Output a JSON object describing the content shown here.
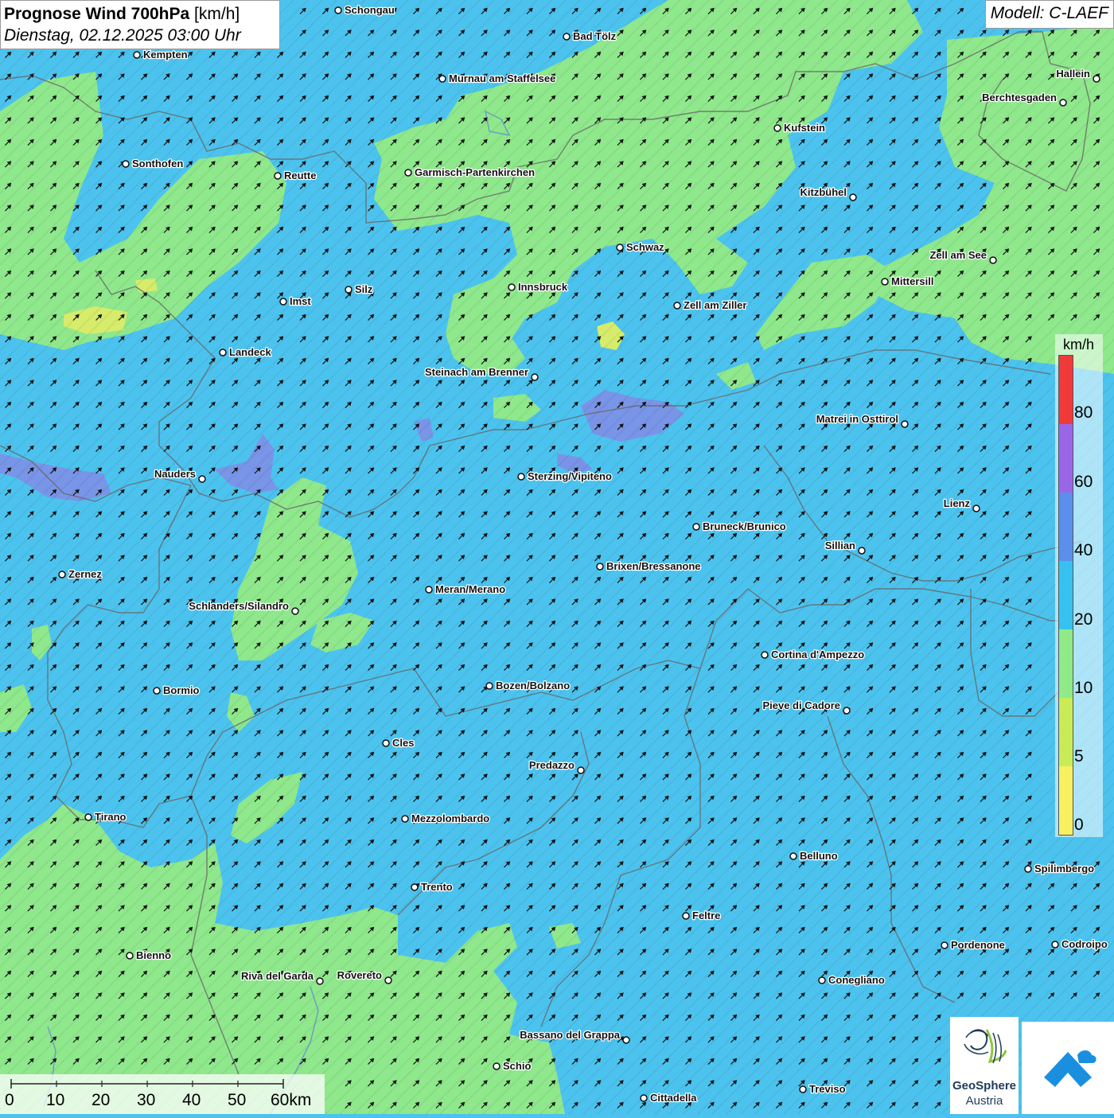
{
  "header": {
    "title_bold": "Prognose Wind 700hPa",
    "title_unit": "[km/h]",
    "datetime": "Dienstag, 02.12.2025 03:00 Uhr",
    "model": "Modell: C-LAEF"
  },
  "legend": {
    "unit": "km/h",
    "ticks": [
      "0",
      "5",
      "10",
      "20",
      "40",
      "60",
      "80"
    ],
    "colors": [
      "#f8f060",
      "#c8ec58",
      "#90ea88",
      "#36c2f0",
      "#5a90ec",
      "#9a66e8",
      "#f03a3a"
    ]
  },
  "scale": {
    "ticks": [
      "0",
      "10",
      "20",
      "30",
      "40",
      "50",
      "60km"
    ]
  },
  "logo": {
    "name": "GeoSphere",
    "sub": "Austria"
  },
  "map": {
    "wind_direction": "from south-west",
    "base_color": "#4cc3ee",
    "cities": [
      {
        "name": "Schongau",
        "side": "right"
      },
      {
        "name": "Bad Tölz",
        "side": "right"
      },
      {
        "name": "Kempten",
        "side": "right"
      },
      {
        "name": "Murnau am Staffelsee",
        "side": "right"
      },
      {
        "name": "Hallein",
        "side": "left"
      },
      {
        "name": "Berchtesgaden",
        "side": "left"
      },
      {
        "name": "Kufstein",
        "side": "right"
      },
      {
        "name": "Sonthofen",
        "side": "right"
      },
      {
        "name": "Reutte",
        "side": "right"
      },
      {
        "name": "Garmisch-Partenkirchen",
        "side": "right"
      },
      {
        "name": "Kitzbühel",
        "side": "left"
      },
      {
        "name": "Schwaz",
        "side": "right"
      },
      {
        "name": "Zell am See",
        "side": "left"
      },
      {
        "name": "Mittersill",
        "side": "right"
      },
      {
        "name": "Innsbruck",
        "side": "right"
      },
      {
        "name": "Silz",
        "side": "right"
      },
      {
        "name": "Imst",
        "side": "right"
      },
      {
        "name": "Zell am Ziller",
        "side": "right"
      },
      {
        "name": "Landeck",
        "side": "right"
      },
      {
        "name": "Steinach am Brenner",
        "side": "left"
      },
      {
        "name": "Matrei in Osttirol",
        "side": "left"
      },
      {
        "name": "Nauders",
        "side": "left"
      },
      {
        "name": "Sterzing/Vipiteno",
        "side": "right"
      },
      {
        "name": "Lienz",
        "side": "left"
      },
      {
        "name": "Bruneck/Brunico",
        "side": "right"
      },
      {
        "name": "Sillian",
        "side": "left"
      },
      {
        "name": "Brixen/Bressanone",
        "side": "right"
      },
      {
        "name": "Zernez",
        "side": "right"
      },
      {
        "name": "Meran/Merano",
        "side": "right"
      },
      {
        "name": "Schlanders/Silandro",
        "side": "left"
      },
      {
        "name": "Cortina d'Ampezzo",
        "side": "right"
      },
      {
        "name": "Bormio",
        "side": "right"
      },
      {
        "name": "Bozen/Bolzano",
        "side": "right"
      },
      {
        "name": "Pieve di Cadore",
        "side": "left"
      },
      {
        "name": "Cles",
        "side": "right"
      },
      {
        "name": "Predazzo",
        "side": "left"
      },
      {
        "name": "Tirano",
        "side": "right"
      },
      {
        "name": "Mezzolombardo",
        "side": "right"
      },
      {
        "name": "Belluno",
        "side": "right"
      },
      {
        "name": "Spilimbergo",
        "side": "right"
      },
      {
        "name": "Trento",
        "side": "right"
      },
      {
        "name": "Feltre",
        "side": "right"
      },
      {
        "name": "Pordenone",
        "side": "right"
      },
      {
        "name": "Codroipo",
        "side": "right"
      },
      {
        "name": "Bienno",
        "side": "right"
      },
      {
        "name": "Riva del Garda",
        "side": "left"
      },
      {
        "name": "Rovereto",
        "side": "left"
      },
      {
        "name": "Conegliano",
        "side": "right"
      },
      {
        "name": "Bassano del Grappa",
        "side": "left"
      },
      {
        "name": "Schio",
        "side": "right"
      },
      {
        "name": "Treviso",
        "side": "right"
      },
      {
        "name": "Cittadella",
        "side": "right"
      }
    ]
  }
}
